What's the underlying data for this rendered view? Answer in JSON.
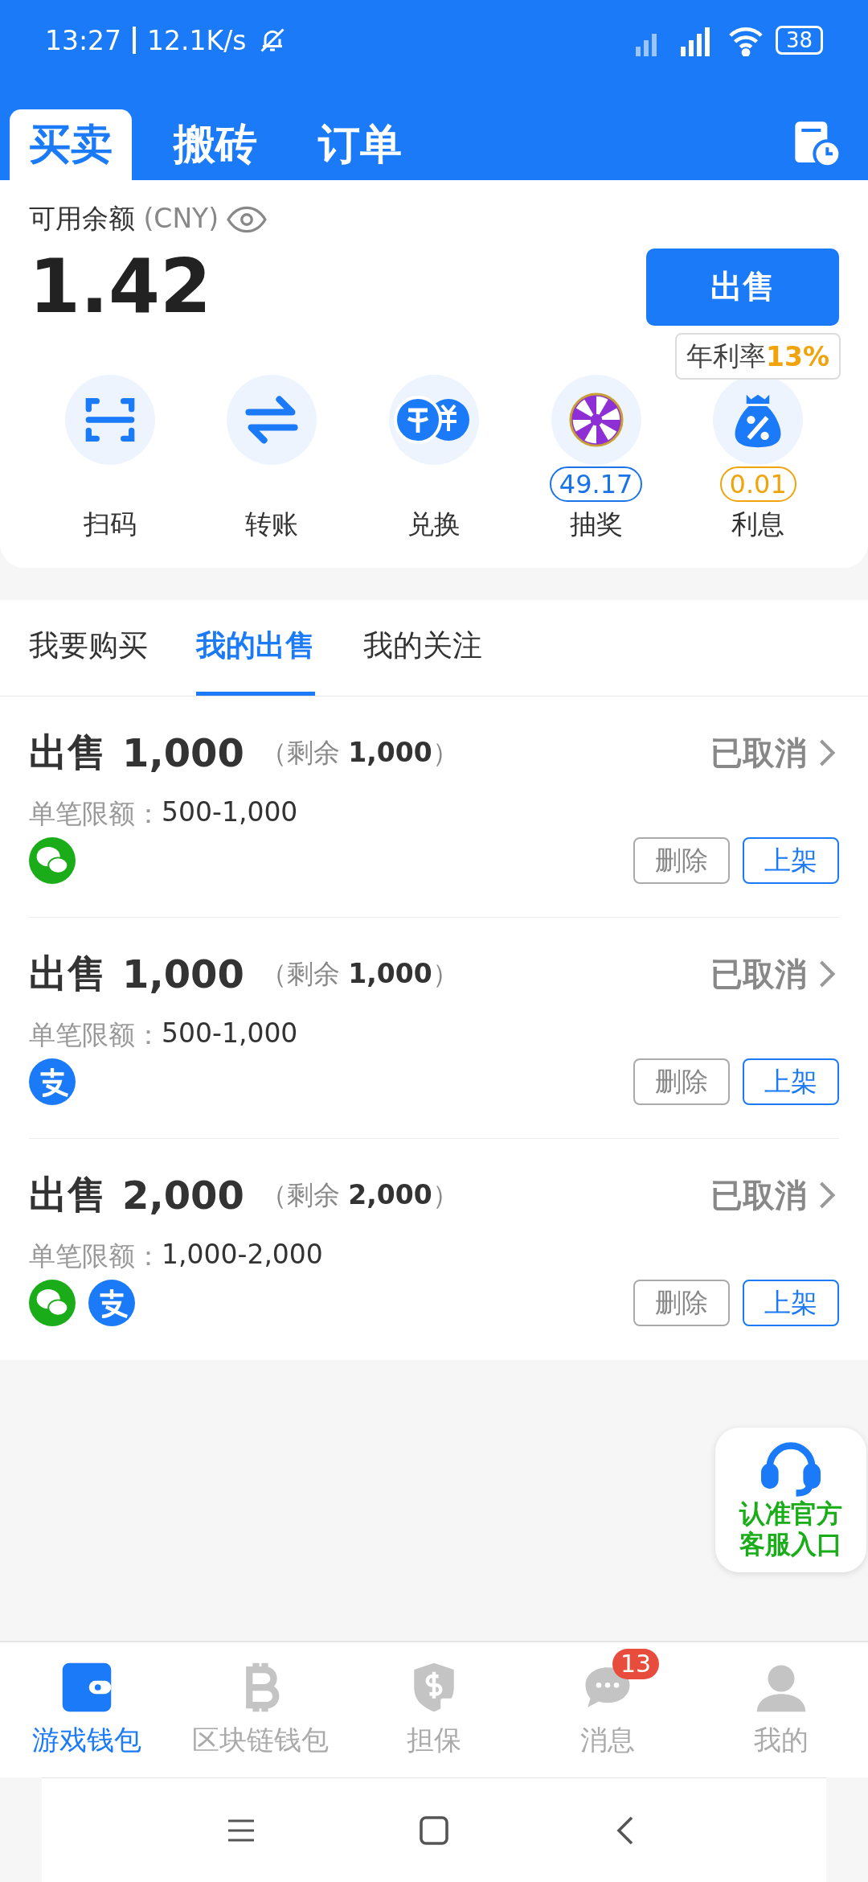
{
  "status_bar": {
    "time": "13:27",
    "speed": "12.1K/s",
    "battery": "38"
  },
  "header_tabs": [
    {
      "label": "买卖",
      "selected": true
    },
    {
      "label": "搬砖",
      "selected": false
    },
    {
      "label": "订单",
      "selected": false
    }
  ],
  "balance": {
    "label": "可用余额",
    "currency": "(CNY)",
    "amount": "1.42",
    "sell_button": "出售",
    "rate_label": "年利率",
    "rate_value": "13%"
  },
  "quick_actions": [
    {
      "kind": "scan",
      "label": "扫码"
    },
    {
      "kind": "transfer",
      "label": "转账"
    },
    {
      "kind": "exchange",
      "label": "兑换"
    },
    {
      "kind": "lottery",
      "label": "抽奖",
      "badge": "49.17",
      "color": "#1a73e8"
    },
    {
      "kind": "interest",
      "label": "利息",
      "badge": "0.01",
      "color": "#f0a30a"
    }
  ],
  "sub_tabs": [
    {
      "label": "我要购买",
      "selected": false
    },
    {
      "label": "我的出售",
      "selected": true
    },
    {
      "label": "我的关注",
      "selected": false
    }
  ],
  "listings": [
    {
      "action": "出售",
      "amount": "1,000",
      "remaining": "（剩余 **1,000**）",
      "limit_label": "单笔限额：",
      "limit": "500-1,000",
      "status": "已取消",
      "payments": [
        {
          "kind": "wechat"
        }
      ],
      "buttons": [
        "删除",
        "上架"
      ]
    },
    {
      "action": "出售",
      "amount": "1,000",
      "remaining": "（剩余 **1,000**）",
      "limit_label": "单笔限额：",
      "limit": "500-1,000",
      "status": "已取消",
      "payments": [
        {
          "kind": "alipay"
        }
      ],
      "buttons": [
        "删除",
        "上架"
      ]
    },
    {
      "action": "出售",
      "amount": "2,000",
      "remaining": "（剩余 **2,000**）",
      "limit_label": "单笔限额：",
      "limit": "1,000-2,000",
      "status": "已取消",
      "payments": [
        {
          "kind": "wechat"
        },
        {
          "kind": "alipay"
        }
      ],
      "buttons": [
        "删除",
        "上架"
      ]
    }
  ],
  "support": {
    "lines": [
      "认准官方",
      "客服入口"
    ]
  },
  "bottom_nav": [
    {
      "kind": "wallet",
      "label": "游戏钱包",
      "selected": true
    },
    {
      "kind": "bitcoin",
      "label": "区块链钱包",
      "selected": false
    },
    {
      "kind": "guarantee",
      "label": "担保",
      "selected": false
    },
    {
      "kind": "messages",
      "label": "消息",
      "selected": false,
      "badge": "13"
    },
    {
      "kind": "profile",
      "label": "我的",
      "selected": false
    }
  ]
}
